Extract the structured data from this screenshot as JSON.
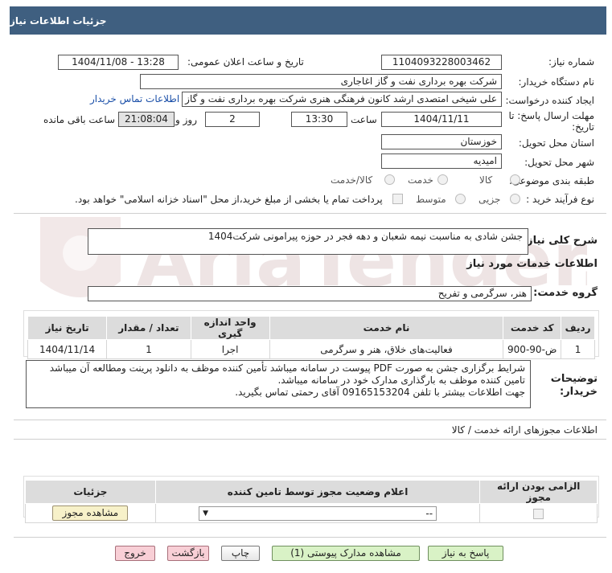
{
  "header": {
    "title": "جزئیات اطلاعات نیاز"
  },
  "watermark": {
    "text": "AriaTender.net"
  },
  "form": {
    "need_number_label": "شماره نیاز:",
    "need_number": "1104093228003462",
    "announce_label": "تاریخ و ساعت اعلان عمومی:",
    "announce_value": "1404/11/08 - 13:28",
    "buyer_org_label": "نام دستگاه خریدار:",
    "buyer_org": "شرکت بهره برداری نفت و گاز اغاجاری",
    "requester_label": "ایجاد کننده درخواست:",
    "requester": "علی شیخی امتصدی ارشد کانون فرهنگی هنری شرکت بهره برداری نفت و گاز ا",
    "contact_link": "اطلاعات تماس خریدار",
    "deadline_label": "مهلت ارسال پاسخ: تا تاریخ:",
    "deadline_date": "1404/11/11",
    "time_label": "ساعت",
    "deadline_time": "13:30",
    "days_label": "روز و",
    "days_value": "2",
    "remaining_time": "21:08:04",
    "remaining_label": "ساعت باقی مانده",
    "province_label": "استان محل تحویل:",
    "province": "خوزستان",
    "city_label": "شهر محل تحویل:",
    "city": "امیدیه",
    "category_label": "طبقه بندی موضوعی:",
    "category_options": [
      "کالا",
      "خدمت",
      "کالا/خدمت"
    ],
    "process_label": "نوع فرآیند خرید :",
    "process_options": [
      "جزیی",
      "متوسط"
    ],
    "payment_note": "پرداخت تمام یا بخشی از مبلغ خرید،از محل \"اسناد خزانه اسلامی\" خواهد بود."
  },
  "description": {
    "label": "شرح کلی نیاز:",
    "value": "جشن شادی به مناسبت نیمه شعبان و دهه فجر در حوزه پیرامونی شرکت1404"
  },
  "services": {
    "title": "اطلاعات خدمات مورد نیاز",
    "group_label": "گروه خدمت:",
    "group_value": "هنر، سرگرمی و تفریح",
    "columns": [
      "ردیف",
      "کد خدمت",
      "نام خدمت",
      "واحد اندازه گیری",
      "تعداد / مقدار",
      "تاریخ نیاز"
    ],
    "rows": [
      [
        "1",
        "ض-90-900",
        "فعالیت‌های خلاق، هنر و سرگرمی",
        "اجرا",
        "1",
        "1404/11/14"
      ]
    ]
  },
  "buyer_notes": {
    "label": "توضیحات خریدار:",
    "lines": [
      "شرایط برگزاری جشن به صورت PDF پیوست در سامانه میباشد تأمین کننده موظف به دانلود پرینت ومطالعه آن میباشد",
      "تامین کننده موظف به بارگذاری مدارک خود در سامانه میباشد.",
      "جهت اطلاعات بیشتر با تلفن 09165153204  آقای رحمتی تماس بگیرید."
    ]
  },
  "permits": {
    "title": "اطلاعات مجوزهای ارائه خدمت / کالا",
    "columns": [
      "الزامی بودن ارائه مجوز",
      "اعلام وضعیت مجوز توسط تامین کننده",
      "جزئیات"
    ],
    "select_value": "--",
    "view_button": "مشاهده مجوز"
  },
  "footer": {
    "respond": "پاسخ به نیاز",
    "view_docs": "مشاهده مدارک پیوستی (1)",
    "print": "چاپ",
    "back": "بازگشت",
    "exit": "خروج"
  }
}
